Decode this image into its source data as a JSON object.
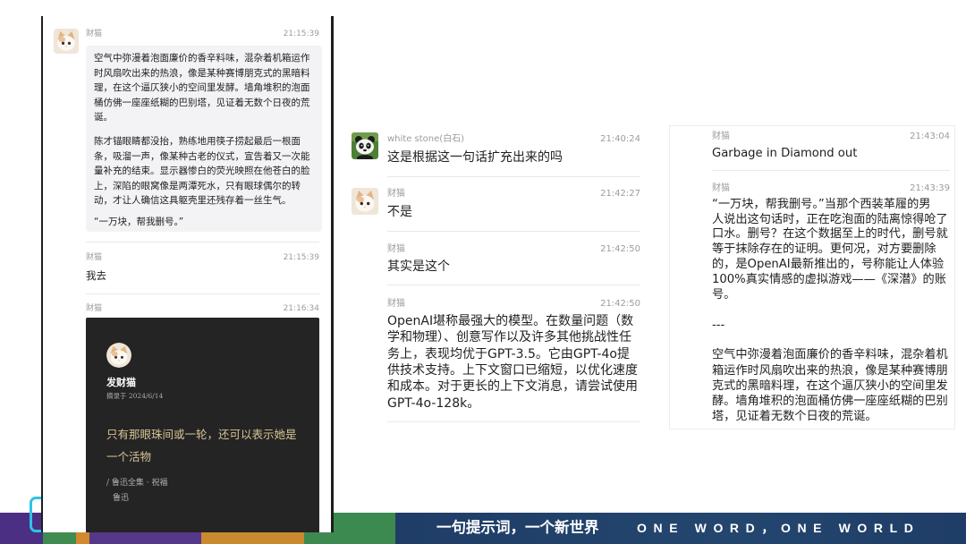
{
  "theme": {
    "panel_border": "#1d1d1d",
    "bubble_bg": "#f3f3f5",
    "card_bg": "#242424",
    "quote_color": "#d6c393",
    "banner_navy": "#1f3d66",
    "stripe_colors": [
      "#4a2f82",
      "#3f8b50",
      "#d2892f",
      "#56388a",
      "#c9892f",
      "#3d8a50"
    ],
    "logo_color": "#2fc3e6"
  },
  "left_chat": {
    "messages": [
      {
        "sender": "财猫",
        "time": "21:15:39",
        "avatar_icon": "cat-avatar-icon",
        "paragraphs": [
          [
            "空气中弥漫着泡面廉价的香辛料味，混杂着机箱运作",
            "时风扇吹出来的热浪，像是某种赛博朋克式的黑暗料",
            "理，在这个逼仄狭小的空间里发酵。墙角堆积的泡面",
            "桶仿佛一座座纸糊的巴别塔，见证着无数个日夜的荒",
            "诞。"
          ],
          [
            "陈才锚眼睛都没抬，熟练地用筷子捞起最后一根面",
            "条，吸溜一声，像某种古老的仪式，宣告着又一次能",
            "量补充的结束。显示器惨白的荧光映照在他苍白的脸",
            "上，深陷的眼窝像是两潭死水，只有眼球偶尔的转",
            "动，才让人确信这具躯壳里还残存着一丝生气。"
          ],
          [
            "“一万块，帮我删号。”"
          ]
        ]
      },
      {
        "sender": "财猫",
        "time": "21:15:39",
        "text": "我去"
      },
      {
        "sender": "财猫",
        "time": "21:16:34",
        "image_card": {
          "avatar_icon": "cat-avatar-icon",
          "author_name": "发财猫",
          "excerpt_date": "摘录于 2024/6/14",
          "quote_lines": [
            "只有那眼珠间或一轮，还可以表示她是",
            "一个活物"
          ],
          "source": "/ 鲁迅全集 · 祝福",
          "source_author": "鲁迅"
        }
      }
    ]
  },
  "middle_chat": {
    "messages": [
      {
        "sender": "white stone(白石)",
        "time": "21:40:24",
        "avatar_icon": "panda-avatar-icon",
        "text": "这是根据这一句话扩充出来的吗"
      },
      {
        "sender": "财猫",
        "time": "21:42:27",
        "avatar_icon": "cat-avatar-icon",
        "text": "不是"
      },
      {
        "sender": "财猫",
        "time": "21:42:50",
        "text": "其实是这个"
      },
      {
        "sender": "财猫",
        "time": "21:42:50",
        "lines": [
          "OpenAI堪称最强大的模型。在数量问题（数",
          "学和物理）、创意写作以及许多其他挑战性任",
          "务上，表现均优于GPT-3.5。它由GPT-4o提",
          "供技术支持。上下文窗口已缩短，以优化速度",
          "和成本。对于更长的上下文消息，请尝试使用",
          "GPT-4o-128k。"
        ]
      }
    ]
  },
  "right_chat": {
    "messages": [
      {
        "sender": "财猫",
        "time": "21:43:04",
        "text": "Garbage in Diamond out"
      },
      {
        "sender": "财猫",
        "time": "21:43:39",
        "paragraph_1": [
          "“一万块，帮我删号。”当那个西装革履的男",
          "人说出这句话时，正在吃泡面的陆离惊得呛了",
          "口水。删号？在这个数据至上的时代，删号就",
          "等于抹除存在的证明。更何况，对方要删除",
          "的，是OpenAI最新推出的，号称能让人体验",
          "100%真实情感的虚拟游戏——《深潜》的账",
          "号。"
        ],
        "separator": "---",
        "paragraph_2": [
          "空气中弥漫着泡面廉价的香辛料味，混杂着机",
          "箱运作时风扇吹出来的热浪，像是某种赛博朋",
          "克式的黑暗料理，在这个逼仄狭小的空间里发",
          "酵。墙角堆积的泡面桶仿佛一座座纸糊的巴别",
          "塔，见证着无数个日夜的荒诞。"
        ]
      }
    ]
  },
  "banner": {
    "title_cn": "一句提示词，一个新世界",
    "title_en": "ONE WORD，ONE WORLD"
  }
}
